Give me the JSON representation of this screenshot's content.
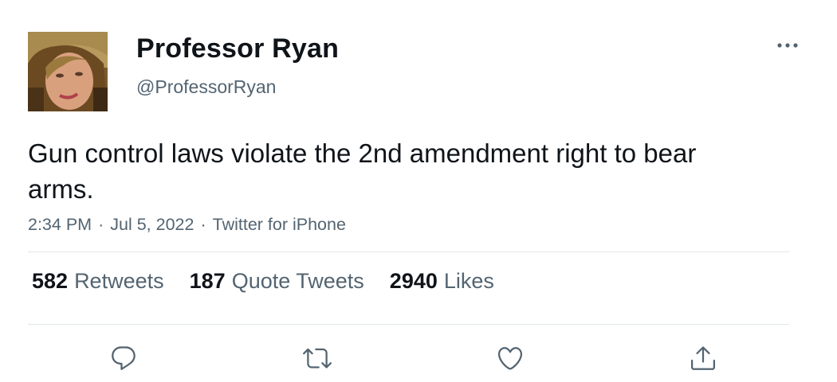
{
  "author": {
    "display_name": "Professor Ryan",
    "handle": "@ProfessorRyan",
    "avatar_icon": "profile-photo"
  },
  "tweet": {
    "text": "Gun control laws violate the 2nd amendment right to bear arms.",
    "time": "2:34 PM",
    "date": "Jul 5, 2022",
    "source": "Twitter for iPhone",
    "separator": "·"
  },
  "stats": {
    "retweets_count": "582",
    "retweets_label": "Retweets",
    "quote_tweets_count": "187",
    "quote_tweets_label": "Quote Tweets",
    "likes_count": "2940",
    "likes_label": "Likes"
  },
  "actions": [
    {
      "name": "reply",
      "icon": "reply-icon"
    },
    {
      "name": "retweet",
      "icon": "retweet-icon"
    },
    {
      "name": "like",
      "icon": "heart-icon"
    },
    {
      "name": "share",
      "icon": "share-icon"
    }
  ],
  "colors": {
    "primary_text": "#0f1419",
    "secondary_text": "#536471",
    "divider": "#e1e5e8",
    "icon": "#536471"
  }
}
